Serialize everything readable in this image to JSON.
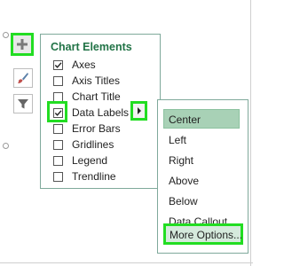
{
  "side_buttons": {
    "add_elements": {
      "icon": "plus-icon"
    },
    "chart_styles": {
      "icon": "paintbrush-icon"
    },
    "chart_filters": {
      "icon": "filter-icon"
    }
  },
  "panel": {
    "title": "Chart Elements",
    "items": [
      {
        "label": "Axes",
        "checked": true
      },
      {
        "label": "Axis Titles",
        "checked": false
      },
      {
        "label": "Chart Title",
        "checked": false
      },
      {
        "label": "Data Labels",
        "checked": true
      },
      {
        "label": "Error Bars",
        "checked": false
      },
      {
        "label": "Gridlines",
        "checked": false
      },
      {
        "label": "Legend",
        "checked": false
      },
      {
        "label": "Trendline",
        "checked": false
      }
    ]
  },
  "submenu": {
    "items": [
      "Center",
      "Left",
      "Right",
      "Above",
      "Below",
      "Data Callout",
      "More Options..."
    ],
    "selected": "Center"
  },
  "colors": {
    "highlight": "#22dd22",
    "title_green": "#217346",
    "selected_fill": "#a8d1b6",
    "hover_fill": "#d5eadc"
  }
}
